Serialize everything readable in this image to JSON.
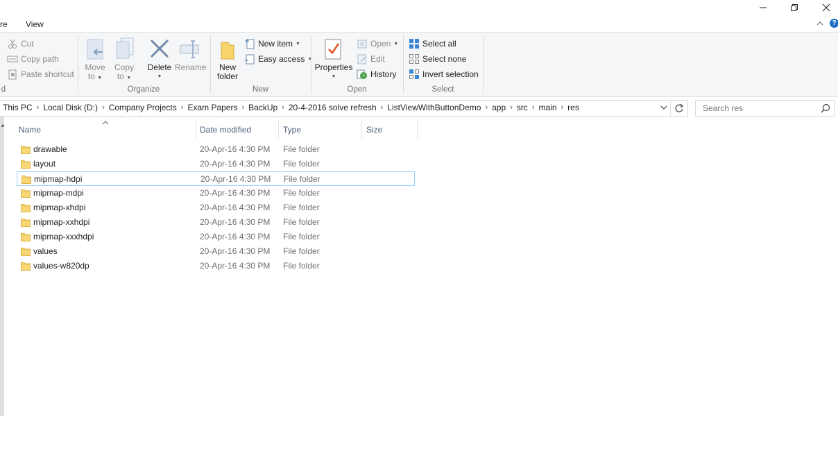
{
  "window": {
    "minimize_icon": "minimize-icon",
    "restore_icon": "restore-icon",
    "close_icon": "close-icon"
  },
  "tabs": [
    {
      "label": "re"
    },
    {
      "label": "View"
    }
  ],
  "ribbon": {
    "clipboard": {
      "cut": "Cut",
      "copy_path": "Copy path",
      "paste_shortcut": "Paste shortcut",
      "label": "d"
    },
    "organize": {
      "move_to": "Move",
      "move_to_2": "to",
      "copy_to": "Copy",
      "copy_to_2": "to",
      "delete": "Delete",
      "rename": "Rename",
      "label": "Organize"
    },
    "new": {
      "new_folder": "New",
      "new_folder_2": "folder",
      "new_item": "New item",
      "easy_access": "Easy access",
      "label": "New"
    },
    "open": {
      "properties": "Properties",
      "open": "Open",
      "edit": "Edit",
      "history": "History",
      "label": "Open"
    },
    "select": {
      "select_all": "Select all",
      "select_none": "Select none",
      "invert": "Invert selection",
      "label": "Select"
    }
  },
  "address": {
    "crumbs": [
      "This PC",
      "Local Disk (D:)",
      "Company Projects",
      "Exam Papers",
      "BackUp",
      "20-4-2016 solve refresh",
      "ListViewWithButtonDemo",
      "app",
      "src",
      "main",
      "res"
    ]
  },
  "search": {
    "placeholder": "Search res"
  },
  "columns": {
    "name": "Name",
    "date": "Date modified",
    "type": "Type",
    "size": "Size"
  },
  "files": [
    {
      "name": "drawable",
      "date": "20-Apr-16 4:30 PM",
      "type": "File folder"
    },
    {
      "name": "layout",
      "date": "20-Apr-16 4:30 PM",
      "type": "File folder"
    },
    {
      "name": "mipmap-hdpi",
      "date": "20-Apr-16 4:30 PM",
      "type": "File folder"
    },
    {
      "name": "mipmap-mdpi",
      "date": "20-Apr-16 4:30 PM",
      "type": "File folder"
    },
    {
      "name": "mipmap-xhdpi",
      "date": "20-Apr-16 4:30 PM",
      "type": "File folder"
    },
    {
      "name": "mipmap-xxhdpi",
      "date": "20-Apr-16 4:30 PM",
      "type": "File folder"
    },
    {
      "name": "mipmap-xxxhdpi",
      "date": "20-Apr-16 4:30 PM",
      "type": "File folder"
    },
    {
      "name": "values",
      "date": "20-Apr-16 4:30 PM",
      "type": "File folder"
    },
    {
      "name": "values-w820dp",
      "date": "20-Apr-16 4:30 PM",
      "type": "File folder"
    }
  ]
}
